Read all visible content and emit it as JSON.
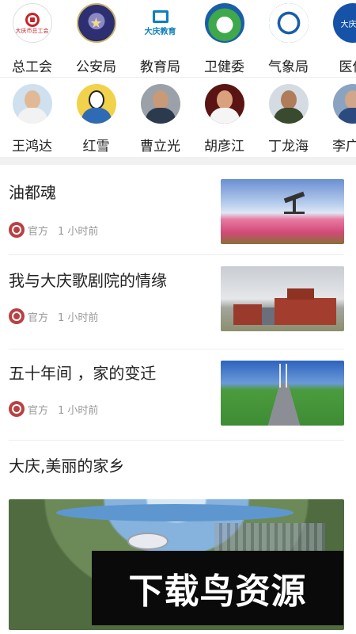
{
  "agencies": [
    {
      "name": "总工会",
      "logo_text": "大庆市总工会"
    },
    {
      "name": "公安局",
      "logo_text": ""
    },
    {
      "name": "教育局",
      "logo_text": "大庆教育"
    },
    {
      "name": "卫健委",
      "logo_text": ""
    },
    {
      "name": "气象局",
      "logo_text": ""
    },
    {
      "name": "医保",
      "logo_text": "大庆医"
    }
  ],
  "people": [
    {
      "name": "王鸿达"
    },
    {
      "name": "红雪"
    },
    {
      "name": "曹立光"
    },
    {
      "name": "胡彦江"
    },
    {
      "name": "丁龙海"
    },
    {
      "name": "李广生"
    }
  ],
  "articles": [
    {
      "title": "油都魂",
      "source": "官方",
      "time": "1 小时前"
    },
    {
      "title": "我与大庆歌剧院的情缘",
      "source": "官方",
      "time": "1 小时前"
    },
    {
      "title": "五十年间 ，家的变迁",
      "source": "官方",
      "time": "1 小时前"
    },
    {
      "title": "大庆,美丽的家乡"
    }
  ],
  "watermark": "下载鸟资源"
}
